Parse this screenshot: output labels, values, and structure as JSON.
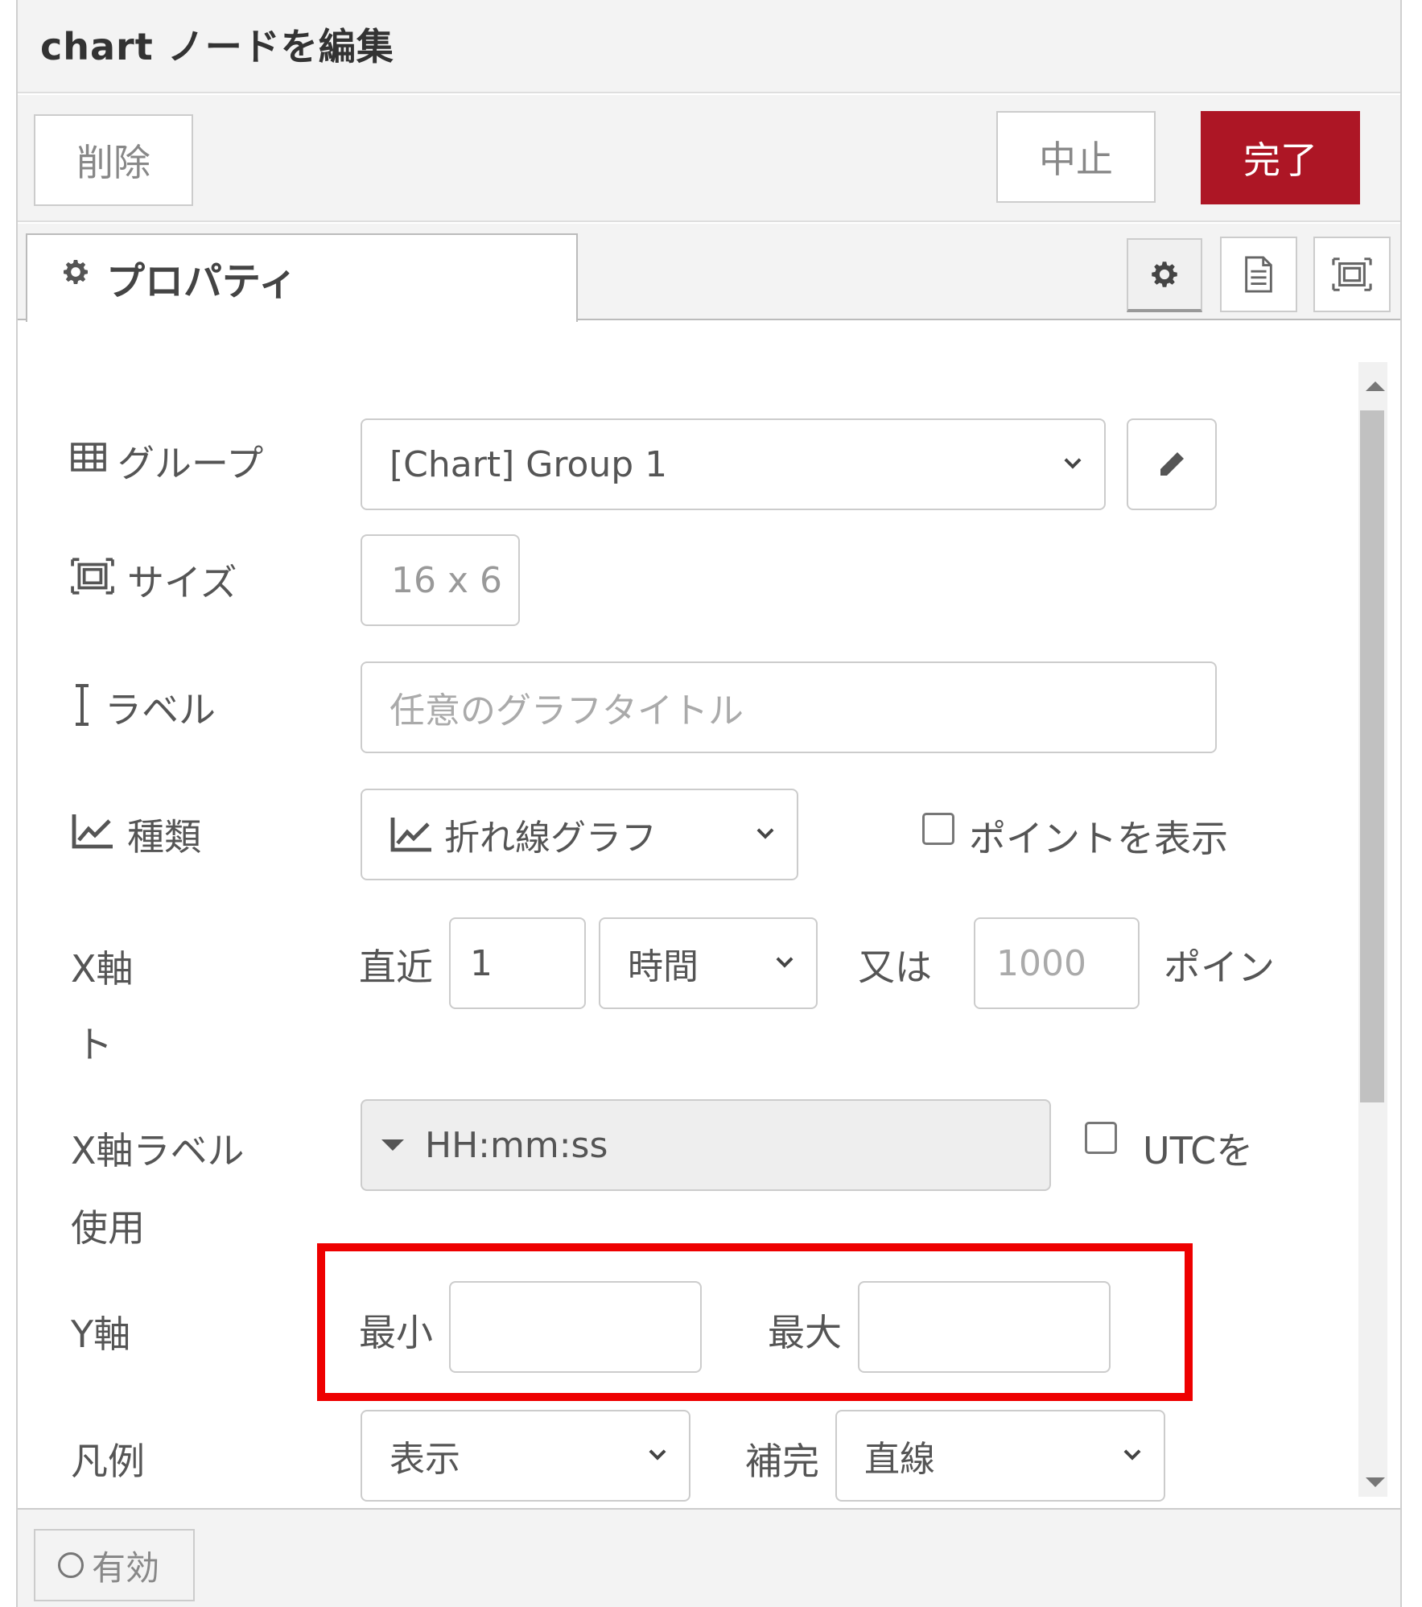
{
  "dialog": {
    "title": "chart ノードを編集"
  },
  "toolbar": {
    "delete_label": "削除",
    "cancel_label": "中止",
    "done_label": "完了"
  },
  "tabs": {
    "properties_label": "プロパティ"
  },
  "form": {
    "group": {
      "label": "グループ",
      "value": "[Chart] Group 1"
    },
    "size": {
      "label": "サイズ",
      "value": "16 x 6"
    },
    "title": {
      "label": "ラベル",
      "placeholder": "任意のグラフタイトル"
    },
    "type": {
      "label": "種類",
      "value": "折れ線グラフ",
      "show_points_label": "ポイントを表示"
    },
    "xaxis": {
      "label": "X軸",
      "label_wrap": "ト",
      "last_label": "直近",
      "last_value": "1",
      "unit_value": "時間",
      "or_label": "又は",
      "points_placeholder": "1000",
      "points_label": "ポイン"
    },
    "xformat": {
      "label": "X軸ラベル",
      "label_wrap": "使用",
      "value": "HH:mm:ss",
      "utc_label": "UTCを"
    },
    "yaxis": {
      "label": "Y軸",
      "min_label": "最小",
      "max_label": "最大",
      "min_value": "",
      "max_value": ""
    },
    "legend": {
      "label": "凡例",
      "value": "表示",
      "interpolate_label": "補完",
      "interpolate_value": "直線"
    }
  },
  "footer": {
    "enabled_label": "有効"
  },
  "colors": {
    "primary": "#ad1625",
    "highlight": "#ee0000"
  },
  "icons": {
    "tab_settings": "gear-icon",
    "panel_buttons": [
      "gear-icon",
      "document-icon",
      "layout-icon"
    ],
    "group": "table-icon",
    "size": "layout-icon",
    "title": "text-cursor-icon",
    "type": "line-chart-icon",
    "edit": "pencil-icon"
  }
}
